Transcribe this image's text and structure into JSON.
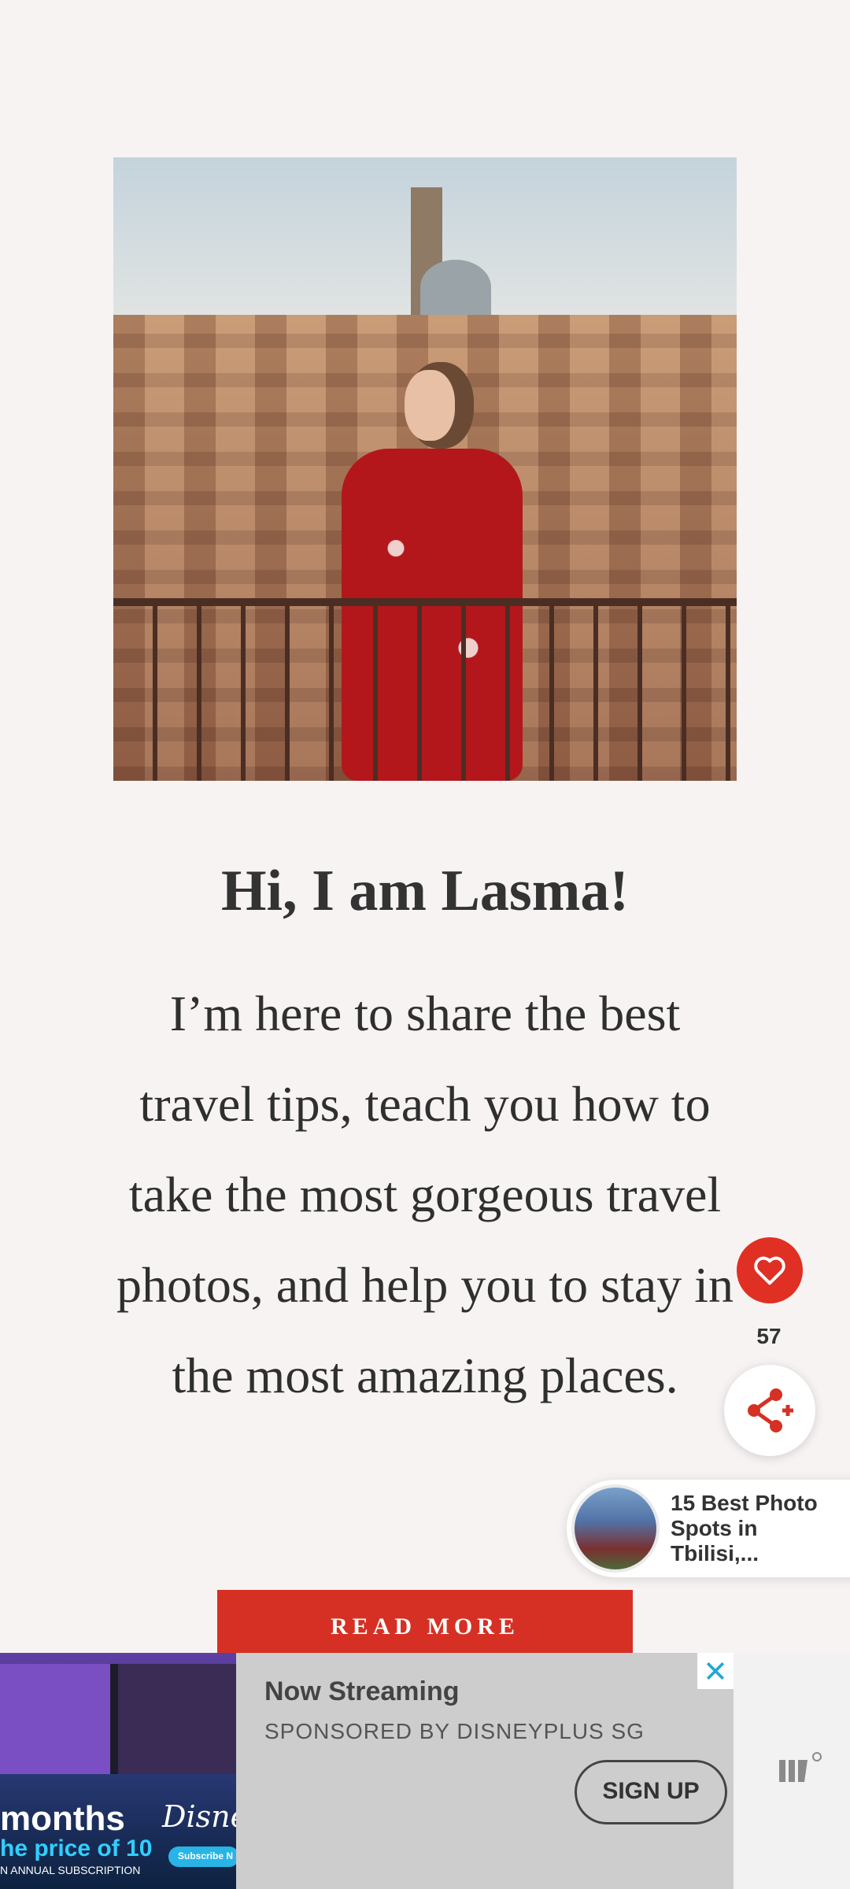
{
  "hero": {
    "image_alt": "Woman in red floral dress on a balcony overlooking Siena rooftops"
  },
  "heading": "Hi, I am Lasma!",
  "intro": "I’m here to share the best travel tips, teach you how to take the most gorgeous travel photos, and help you to stay in the most amazing places.",
  "cta": {
    "read_more": "READ MORE"
  },
  "social": {
    "favorite_icon": "heart-icon",
    "share_count": "57",
    "share_icon": "share-icon"
  },
  "related": {
    "title": "15 Best Photo Spots in Tbilisi,..."
  },
  "ad": {
    "image_text": {
      "headline": "months",
      "subline": "he price of 10",
      "fine": "N ANNUAL SUBSCRIPTION",
      "brand": "Disney",
      "button": "Subscribe N"
    },
    "title": "Now Streaming",
    "sponsor": "SPONSORED BY DISNEYPLUS SG",
    "signup": "SIGN UP",
    "close_icon": "close-icon",
    "logo_icon": "mediavine-logo-icon"
  },
  "colors": {
    "background": "#f6f3f2",
    "accent_red": "#d63024",
    "heart_red": "#e02f23",
    "ad_panel": "#cdcdcd",
    "close_blue": "#22a7d8"
  }
}
